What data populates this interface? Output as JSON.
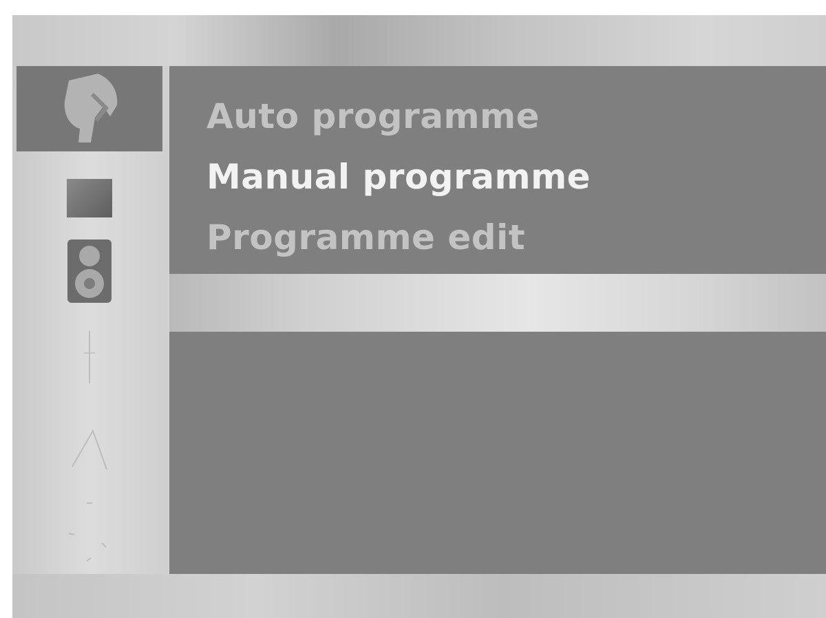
{
  "menu": {
    "items": [
      {
        "label": "Auto programme",
        "selected": false
      },
      {
        "label": "Manual programme",
        "selected": true
      },
      {
        "label": "Programme edit",
        "selected": false
      }
    ]
  },
  "sidebar": {
    "items": [
      {
        "icon": "satellite-dish-icon",
        "active": true
      },
      {
        "icon": "picture-icon",
        "active": false
      },
      {
        "icon": "speaker-icon",
        "active": false
      },
      {
        "icon": "clock-icon",
        "active": false
      },
      {
        "icon": "antenna-icon",
        "active": false
      },
      {
        "icon": "settings-icon",
        "active": false
      }
    ]
  },
  "colors": {
    "panel": "#7f7f7f",
    "active_item": "#777777",
    "selected_text": "#f2f2f2",
    "normal_text": "#c3c3c3"
  }
}
